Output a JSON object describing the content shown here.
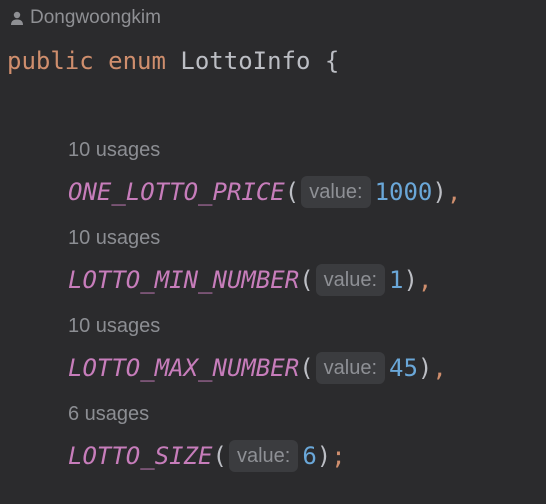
{
  "author": {
    "icon": "person-icon",
    "name": "Dongwoongkim"
  },
  "declaration": {
    "modifier": "public",
    "keyword": "enum",
    "name": "LottoInfo",
    "open_brace": "{"
  },
  "entries": [
    {
      "usages": "10 usages",
      "name": "ONE_LOTTO_PRICE",
      "hint": "value:",
      "value": "1000",
      "terminator": ","
    },
    {
      "usages": "10 usages",
      "name": "LOTTO_MIN_NUMBER",
      "hint": "value:",
      "value": "1",
      "terminator": ","
    },
    {
      "usages": "10 usages",
      "name": "LOTTO_MAX_NUMBER",
      "hint": "value:",
      "value": "45",
      "terminator": ","
    },
    {
      "usages": "6 usages",
      "name": "LOTTO_SIZE",
      "hint": "value:",
      "value": "6",
      "terminator": ";"
    }
  ],
  "punct": {
    "open_paren": "(",
    "close_paren": ")"
  },
  "colors": {
    "background": "#2b2b2d",
    "keyword": "#cf8e6d",
    "constant": "#c77dbb",
    "number": "#6aa7d8",
    "text": "#bcbec4",
    "hint_bg": "#3b3c3f"
  }
}
